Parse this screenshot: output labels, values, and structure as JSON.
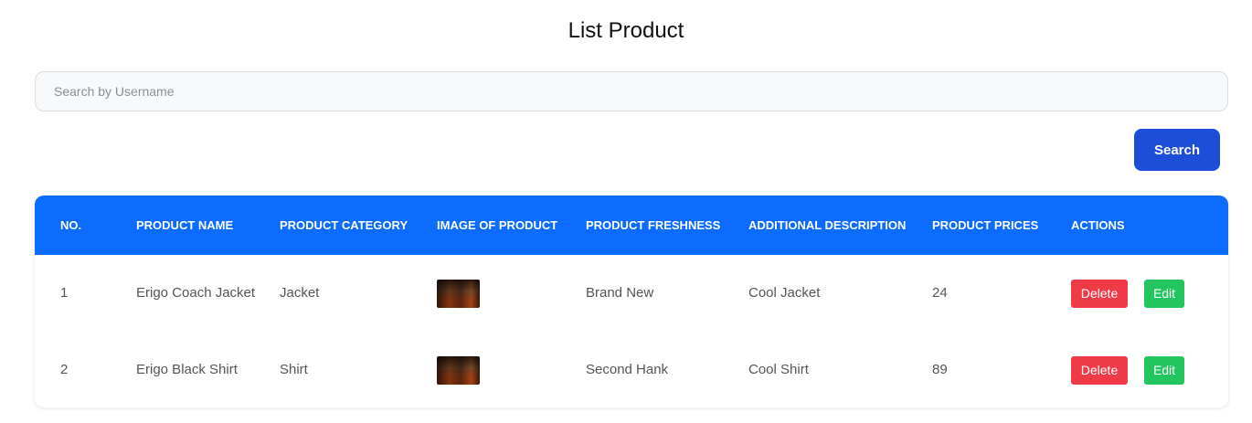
{
  "page": {
    "title": "List Product"
  },
  "search": {
    "placeholder": "Search by Username",
    "value": "",
    "button_label": "Search"
  },
  "table": {
    "headers": [
      "NO.",
      "PRODUCT NAME",
      "PRODUCT CATEGORY",
      "IMAGE OF PRODUCT",
      "PRODUCT FRESHNESS",
      "ADDITIONAL DESCRIPTION",
      "PRODUCT PRICES",
      "ACTIONS"
    ],
    "rows": [
      {
        "no": "1",
        "name": "Erigo Coach Jacket",
        "category": "Jacket",
        "image_icon": "product-thumbnail",
        "freshness": "Brand New",
        "description": "Cool Jacket",
        "price": "24",
        "delete_label": "Delete",
        "edit_label": "Edit"
      },
      {
        "no": "2",
        "name": "Erigo Black Shirt",
        "category": "Shirt",
        "image_icon": "product-thumbnail",
        "freshness": "Second Hank",
        "description": "Cool Shirt",
        "price": "89",
        "delete_label": "Delete",
        "edit_label": "Edit"
      }
    ]
  },
  "colors": {
    "header_bg": "#0b6cff",
    "search_button": "#1d4ed8",
    "delete_button": "#ef3b47",
    "edit_button": "#22c55e"
  }
}
